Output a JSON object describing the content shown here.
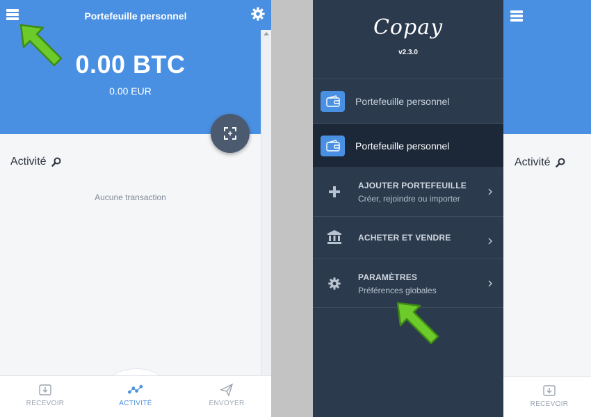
{
  "left_screen": {
    "header": {
      "title": "Portefeuille personnel"
    },
    "balance": {
      "amount": "0.00 BTC",
      "alternative": "0.00 EUR"
    },
    "activity": {
      "label": "Activité",
      "empty_message": "Aucune transaction"
    },
    "tabs": [
      {
        "label": "RECEVOIR",
        "icon": "receive-icon",
        "active": false
      },
      {
        "label": "ACTIVITÉ",
        "icon": "activity-icon",
        "active": true
      },
      {
        "label": "ENVOYER",
        "icon": "send-icon",
        "active": false
      }
    ]
  },
  "drawer": {
    "logo": "Copay",
    "version": "v2.3.0",
    "wallets": [
      {
        "label": "Portefeuille personnel",
        "selected": false
      },
      {
        "label": "Portefeuille personnel",
        "selected": true
      }
    ],
    "actions": [
      {
        "title": "AJOUTER PORTEFEUILLE",
        "subtitle": "Créer, rejoindre ou importer",
        "icon": "plus-icon"
      },
      {
        "title": "ACHETER ET VENDRE",
        "subtitle": "",
        "icon": "bank-icon"
      },
      {
        "title": "PARAMÈTRES",
        "subtitle": "Préférences globales",
        "icon": "gear-icon"
      }
    ]
  },
  "right_screen": {
    "activity": {
      "label": "Activité"
    },
    "tabs": [
      {
        "label": "RECEVOIR",
        "icon": "receive-icon"
      }
    ]
  },
  "colors": {
    "brand_blue": "#4a90e2",
    "drawer_bg": "#2b3a4d",
    "drawer_selected_bg": "#1c2838",
    "annotation_arrow": "#6ccb2a"
  }
}
